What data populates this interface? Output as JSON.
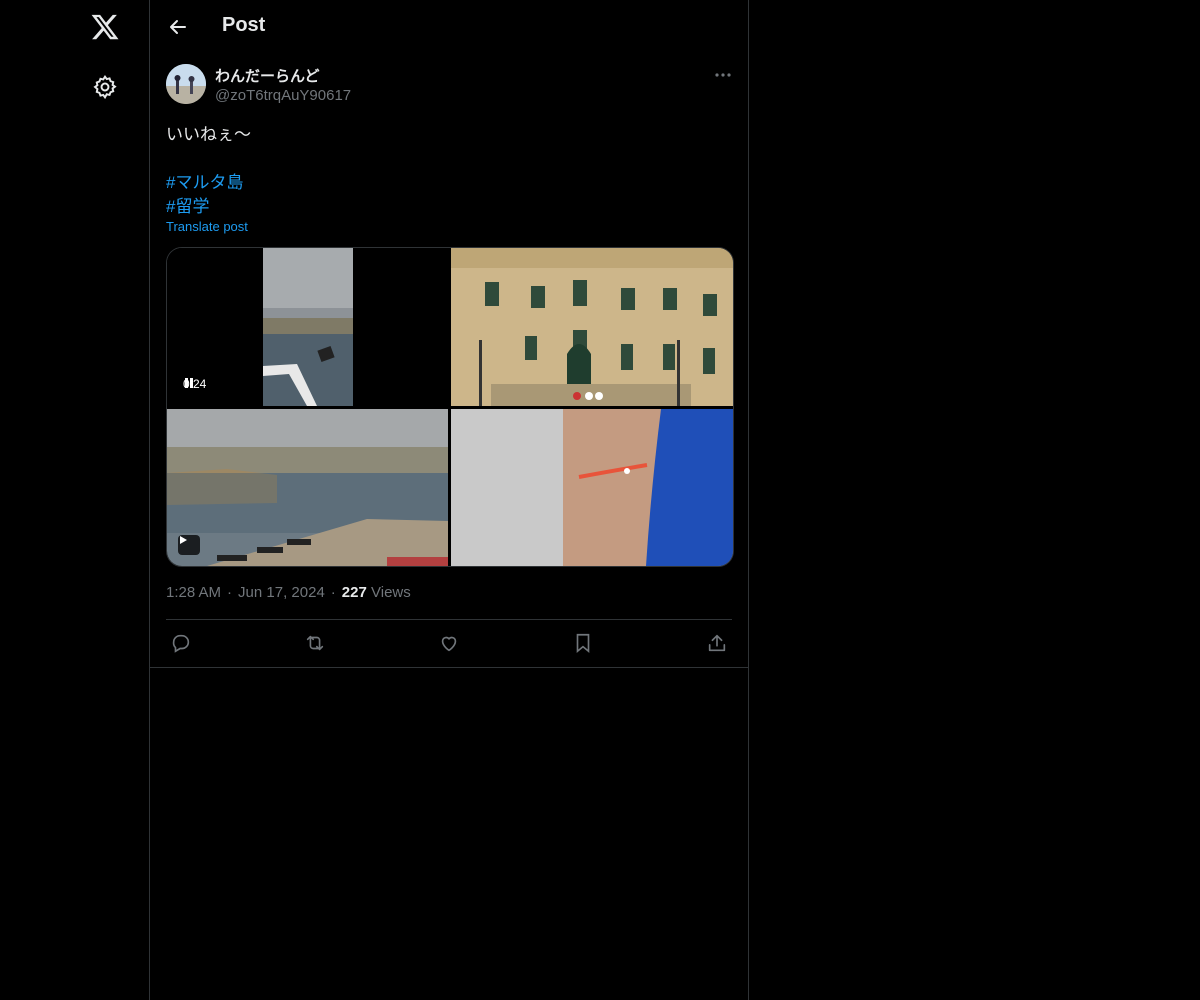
{
  "nav": {
    "logo_icon": "x-logo-icon",
    "settings_icon": "gear-icon"
  },
  "header": {
    "back_icon": "arrow-left-icon",
    "title": "Post"
  },
  "post": {
    "author": {
      "display_name": "わんだーらんど",
      "handle": "@zoT6trqAuY90617"
    },
    "more_icon": "more-horizontal-icon",
    "text": "いいねぇ〜",
    "hashtags": [
      "#マルタ島",
      "#留学"
    ],
    "translate_label": "Translate post",
    "media": [
      {
        "kind": "video",
        "time": "0:24",
        "state": "playing",
        "scene": "harbor view from ferry"
      },
      {
        "kind": "image",
        "scene": "baroque palace facade"
      },
      {
        "kind": "video",
        "state": "paused",
        "scene": "grand harbour with cannons"
      },
      {
        "kind": "image",
        "scene": "beaded bracelet on wrist"
      }
    ],
    "meta": {
      "time": "1:28 AM",
      "date": "Jun 17, 2024",
      "views_count": "227",
      "views_label": "Views"
    },
    "actions": [
      {
        "name": "reply",
        "icon": "reply-icon"
      },
      {
        "name": "repost",
        "icon": "repost-icon"
      },
      {
        "name": "like",
        "icon": "heart-icon"
      },
      {
        "name": "bookmark",
        "icon": "bookmark-icon"
      },
      {
        "name": "share",
        "icon": "share-icon"
      }
    ]
  },
  "colors": {
    "background": "#000000",
    "text_primary": "#e7e9ea",
    "text_secondary": "#71767b",
    "accent": "#1d9bf0",
    "border": "#2f3336"
  }
}
